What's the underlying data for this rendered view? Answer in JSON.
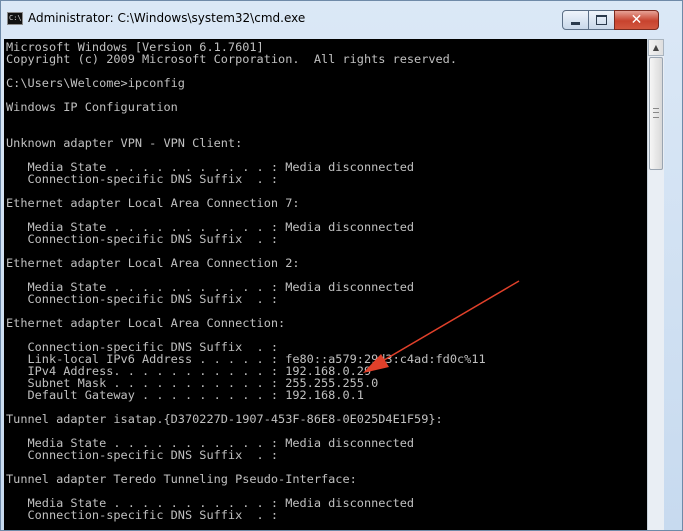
{
  "window": {
    "title": "Administrator: C:\\Windows\\system32\\cmd.exe",
    "app_icon_text": "C:\\"
  },
  "console": {
    "lines": [
      "Microsoft Windows [Version 6.1.7601]",
      "Copyright (c) 2009 Microsoft Corporation.  All rights reserved.",
      "",
      "C:\\Users\\Welcome>ipconfig",
      "",
      "Windows IP Configuration",
      "",
      "",
      "Unknown adapter VPN - VPN Client:",
      "",
      "   Media State . . . . . . . . . . . : Media disconnected",
      "   Connection-specific DNS Suffix  . :",
      "",
      "Ethernet adapter Local Area Connection 7:",
      "",
      "   Media State . . . . . . . . . . . : Media disconnected",
      "   Connection-specific DNS Suffix  . :",
      "",
      "Ethernet adapter Local Area Connection 2:",
      "",
      "   Media State . . . . . . . . . . . : Media disconnected",
      "   Connection-specific DNS Suffix  . :",
      "",
      "Ethernet adapter Local Area Connection:",
      "",
      "   Connection-specific DNS Suffix  . :",
      "   Link-local IPv6 Address . . . . . : fe80::a579:29d3:c4ad:fd0c%11",
      "   IPv4 Address. . . . . . . . . . . : 192.168.0.29",
      "   Subnet Mask . . . . . . . . . . . : 255.255.255.0",
      "   Default Gateway . . . . . . . . . : 192.168.0.1",
      "",
      "Tunnel adapter isatap.{D370227D-1907-453F-86E8-0E025D4E1F59}:",
      "",
      "   Media State . . . . . . . . . . . : Media disconnected",
      "   Connection-specific DNS Suffix  . :",
      "",
      "Tunnel adapter Teredo Tunneling Pseudo-Interface:",
      "",
      "   Media State . . . . . . . . . . . : Media disconnected",
      "   Connection-specific DNS Suffix  . :"
    ]
  },
  "colors": {
    "console_bg": "#000000",
    "console_fg": "#c0c0c0",
    "annotation_arrow": "#e0402a",
    "close_button": "#c8432e"
  },
  "icons": {
    "minimize": "minimize-icon",
    "maximize": "maximize-icon",
    "close": "close-icon",
    "scroll_up": "chevron-up-icon"
  },
  "glyphs": {
    "close": "✕",
    "scroll_up": "▲"
  }
}
